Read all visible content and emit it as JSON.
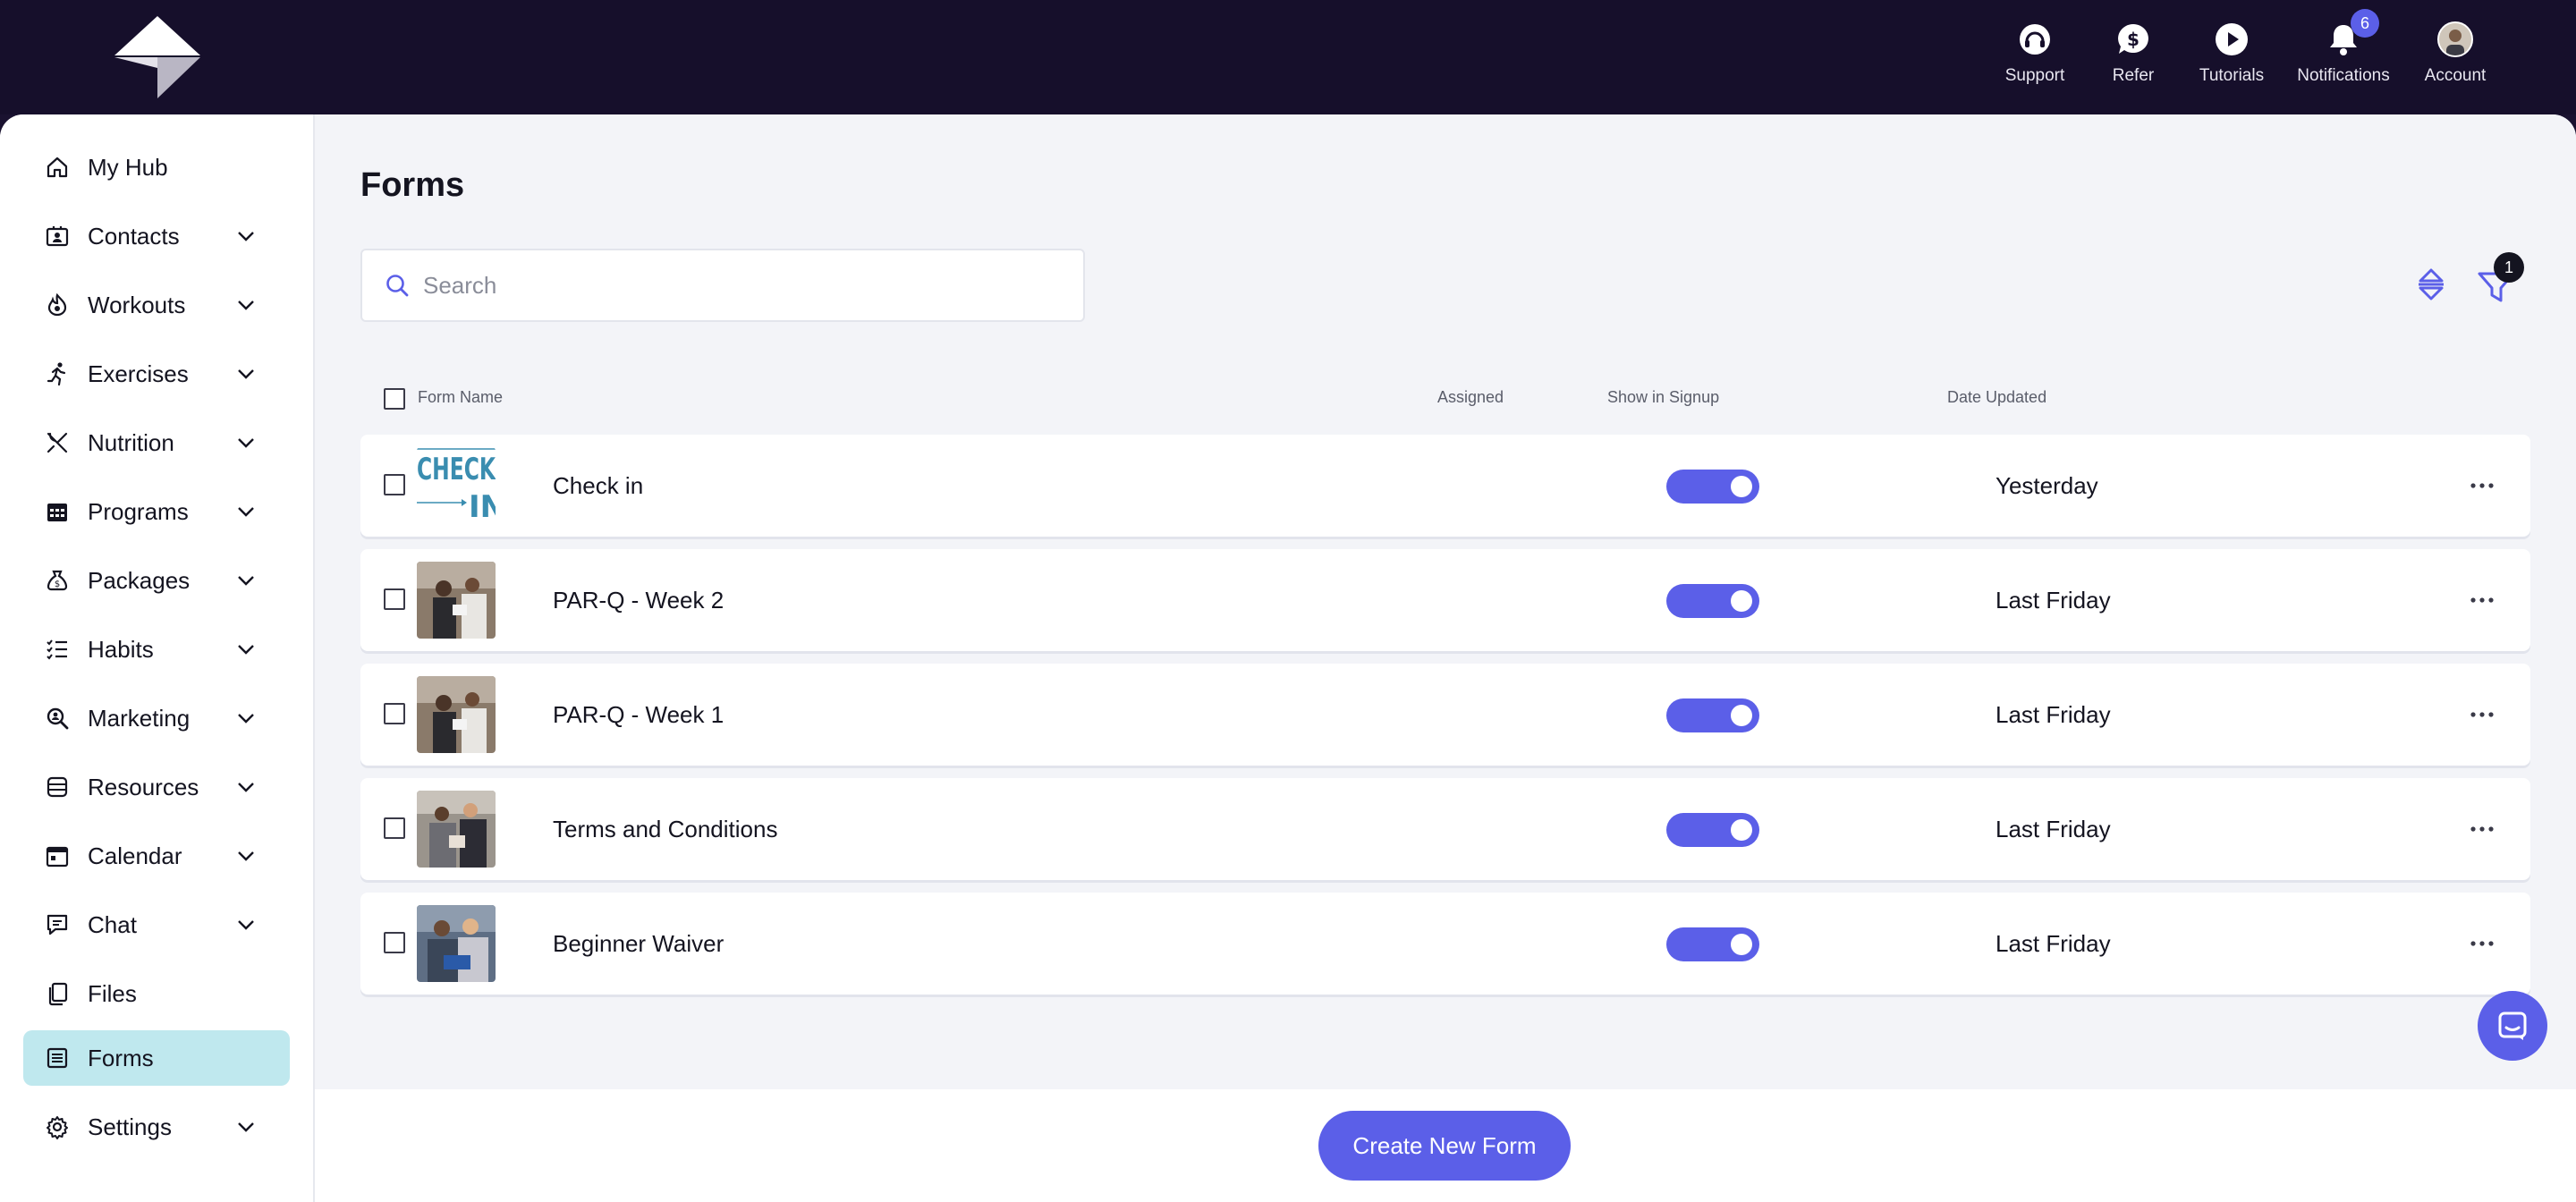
{
  "topbar": {
    "nav": [
      {
        "label": "Support",
        "icon": "headset-icon"
      },
      {
        "label": "Refer",
        "icon": "dollar-chat-icon"
      },
      {
        "label": "Tutorials",
        "icon": "play-icon"
      },
      {
        "label": "Notifications",
        "icon": "bell-icon",
        "badge": "6"
      },
      {
        "label": "Account",
        "icon": "avatar"
      }
    ]
  },
  "sidebar": {
    "items": [
      {
        "label": "My Hub",
        "icon": "home-icon",
        "expandable": false
      },
      {
        "label": "Contacts",
        "icon": "contacts-icon",
        "expandable": true
      },
      {
        "label": "Workouts",
        "icon": "flame-icon",
        "expandable": true
      },
      {
        "label": "Exercises",
        "icon": "running-icon",
        "expandable": true
      },
      {
        "label": "Nutrition",
        "icon": "utensils-icon",
        "expandable": true
      },
      {
        "label": "Programs",
        "icon": "calendar-grid-icon",
        "expandable": true
      },
      {
        "label": "Packages",
        "icon": "money-bag-icon",
        "expandable": true
      },
      {
        "label": "Habits",
        "icon": "checklist-icon",
        "expandable": true
      },
      {
        "label": "Marketing",
        "icon": "magnify-icon",
        "expandable": true
      },
      {
        "label": "Resources",
        "icon": "database-icon",
        "expandable": true
      },
      {
        "label": "Calendar",
        "icon": "calendar-icon",
        "expandable": true
      },
      {
        "label": "Chat",
        "icon": "chat-icon",
        "expandable": true
      },
      {
        "label": "Files",
        "icon": "files-icon",
        "expandable": false
      },
      {
        "label": "Forms",
        "icon": "form-icon",
        "expandable": false,
        "active": true
      },
      {
        "label": "Settings",
        "icon": "gear-icon",
        "expandable": true
      }
    ]
  },
  "main": {
    "title": "Forms",
    "search_placeholder": "Search",
    "filter_count": "1",
    "columns": {
      "name": "Form Name",
      "assigned": "Assigned",
      "show_in_signup": "Show in Signup",
      "date_updated": "Date Updated"
    },
    "rows": [
      {
        "name": "Check in",
        "show_in_signup": true,
        "date_updated": "Yesterday",
        "thumb": "checkin"
      },
      {
        "name": "PAR-Q - Week 2",
        "show_in_signup": true,
        "date_updated": "Last Friday",
        "thumb": "photo-a"
      },
      {
        "name": "PAR-Q - Week 1",
        "show_in_signup": true,
        "date_updated": "Last Friday",
        "thumb": "photo-a"
      },
      {
        "name": "Terms and Conditions",
        "show_in_signup": true,
        "date_updated": "Last Friday",
        "thumb": "photo-b"
      },
      {
        "name": "Beginner Waiver",
        "show_in_signup": true,
        "date_updated": "Last Friday",
        "thumb": "photo-c"
      }
    ],
    "create_button": "Create New Form"
  },
  "colors": {
    "topbar_bg": "#160f2b",
    "accent": "#5b5fe8",
    "active_nav": "#bfe8ee"
  },
  "thumb_text": {
    "line1": "CHECK",
    "line2": "IN"
  }
}
